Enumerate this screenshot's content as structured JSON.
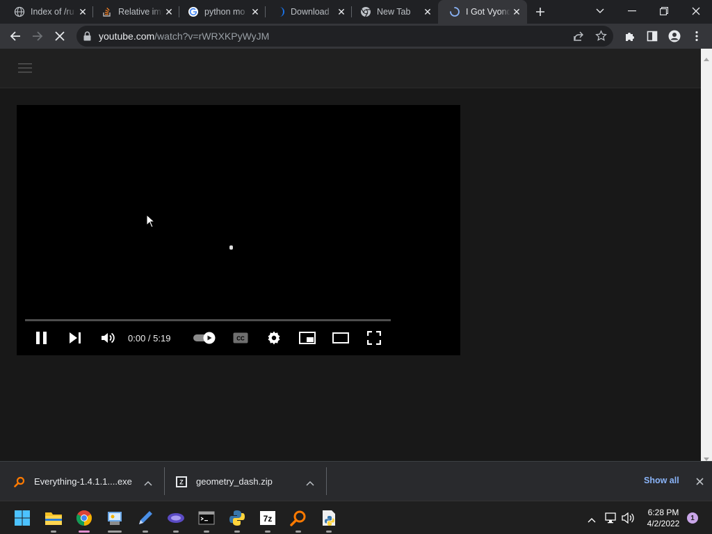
{
  "tabs": [
    {
      "title": "Index of /ru",
      "icon": "globe-icon"
    },
    {
      "title": "Relative imp",
      "icon": "stackoverflow-icon"
    },
    {
      "title": "python mo",
      "icon": "google-icon"
    },
    {
      "title": "Download",
      "icon": "download-site-icon"
    },
    {
      "title": "New Tab",
      "icon": "chrome-icon"
    },
    {
      "title": "I Got Vyond",
      "icon": "loading-spinner-icon",
      "active": true
    }
  ],
  "address": {
    "host": "youtube.com",
    "path": "/watch?v=rWRXKPyWyJM"
  },
  "player": {
    "time": "0:00 / 5:19",
    "progress_fraction": 0.0
  },
  "downloads": [
    {
      "name": "Everything-1.4.1.1....exe",
      "icon": "everything-search-icon"
    },
    {
      "name": "geometry_dash.zip",
      "icon": "zip-archive-icon"
    }
  ],
  "downloads_show_all": "Show all",
  "taskbar": {
    "apps": [
      "start",
      "file-explorer",
      "chrome",
      "control-panel",
      "pen-app",
      "vpn-app",
      "terminal",
      "python",
      "7zip",
      "everything",
      "python-launcher"
    ],
    "time": "6:28 PM",
    "date": "4/2/2022",
    "notification_count": "1"
  },
  "colors": {
    "tab_strip": "#202124",
    "toolbar": "#35363a",
    "page_bg": "#181818",
    "link_blue": "#8ab4f8"
  }
}
